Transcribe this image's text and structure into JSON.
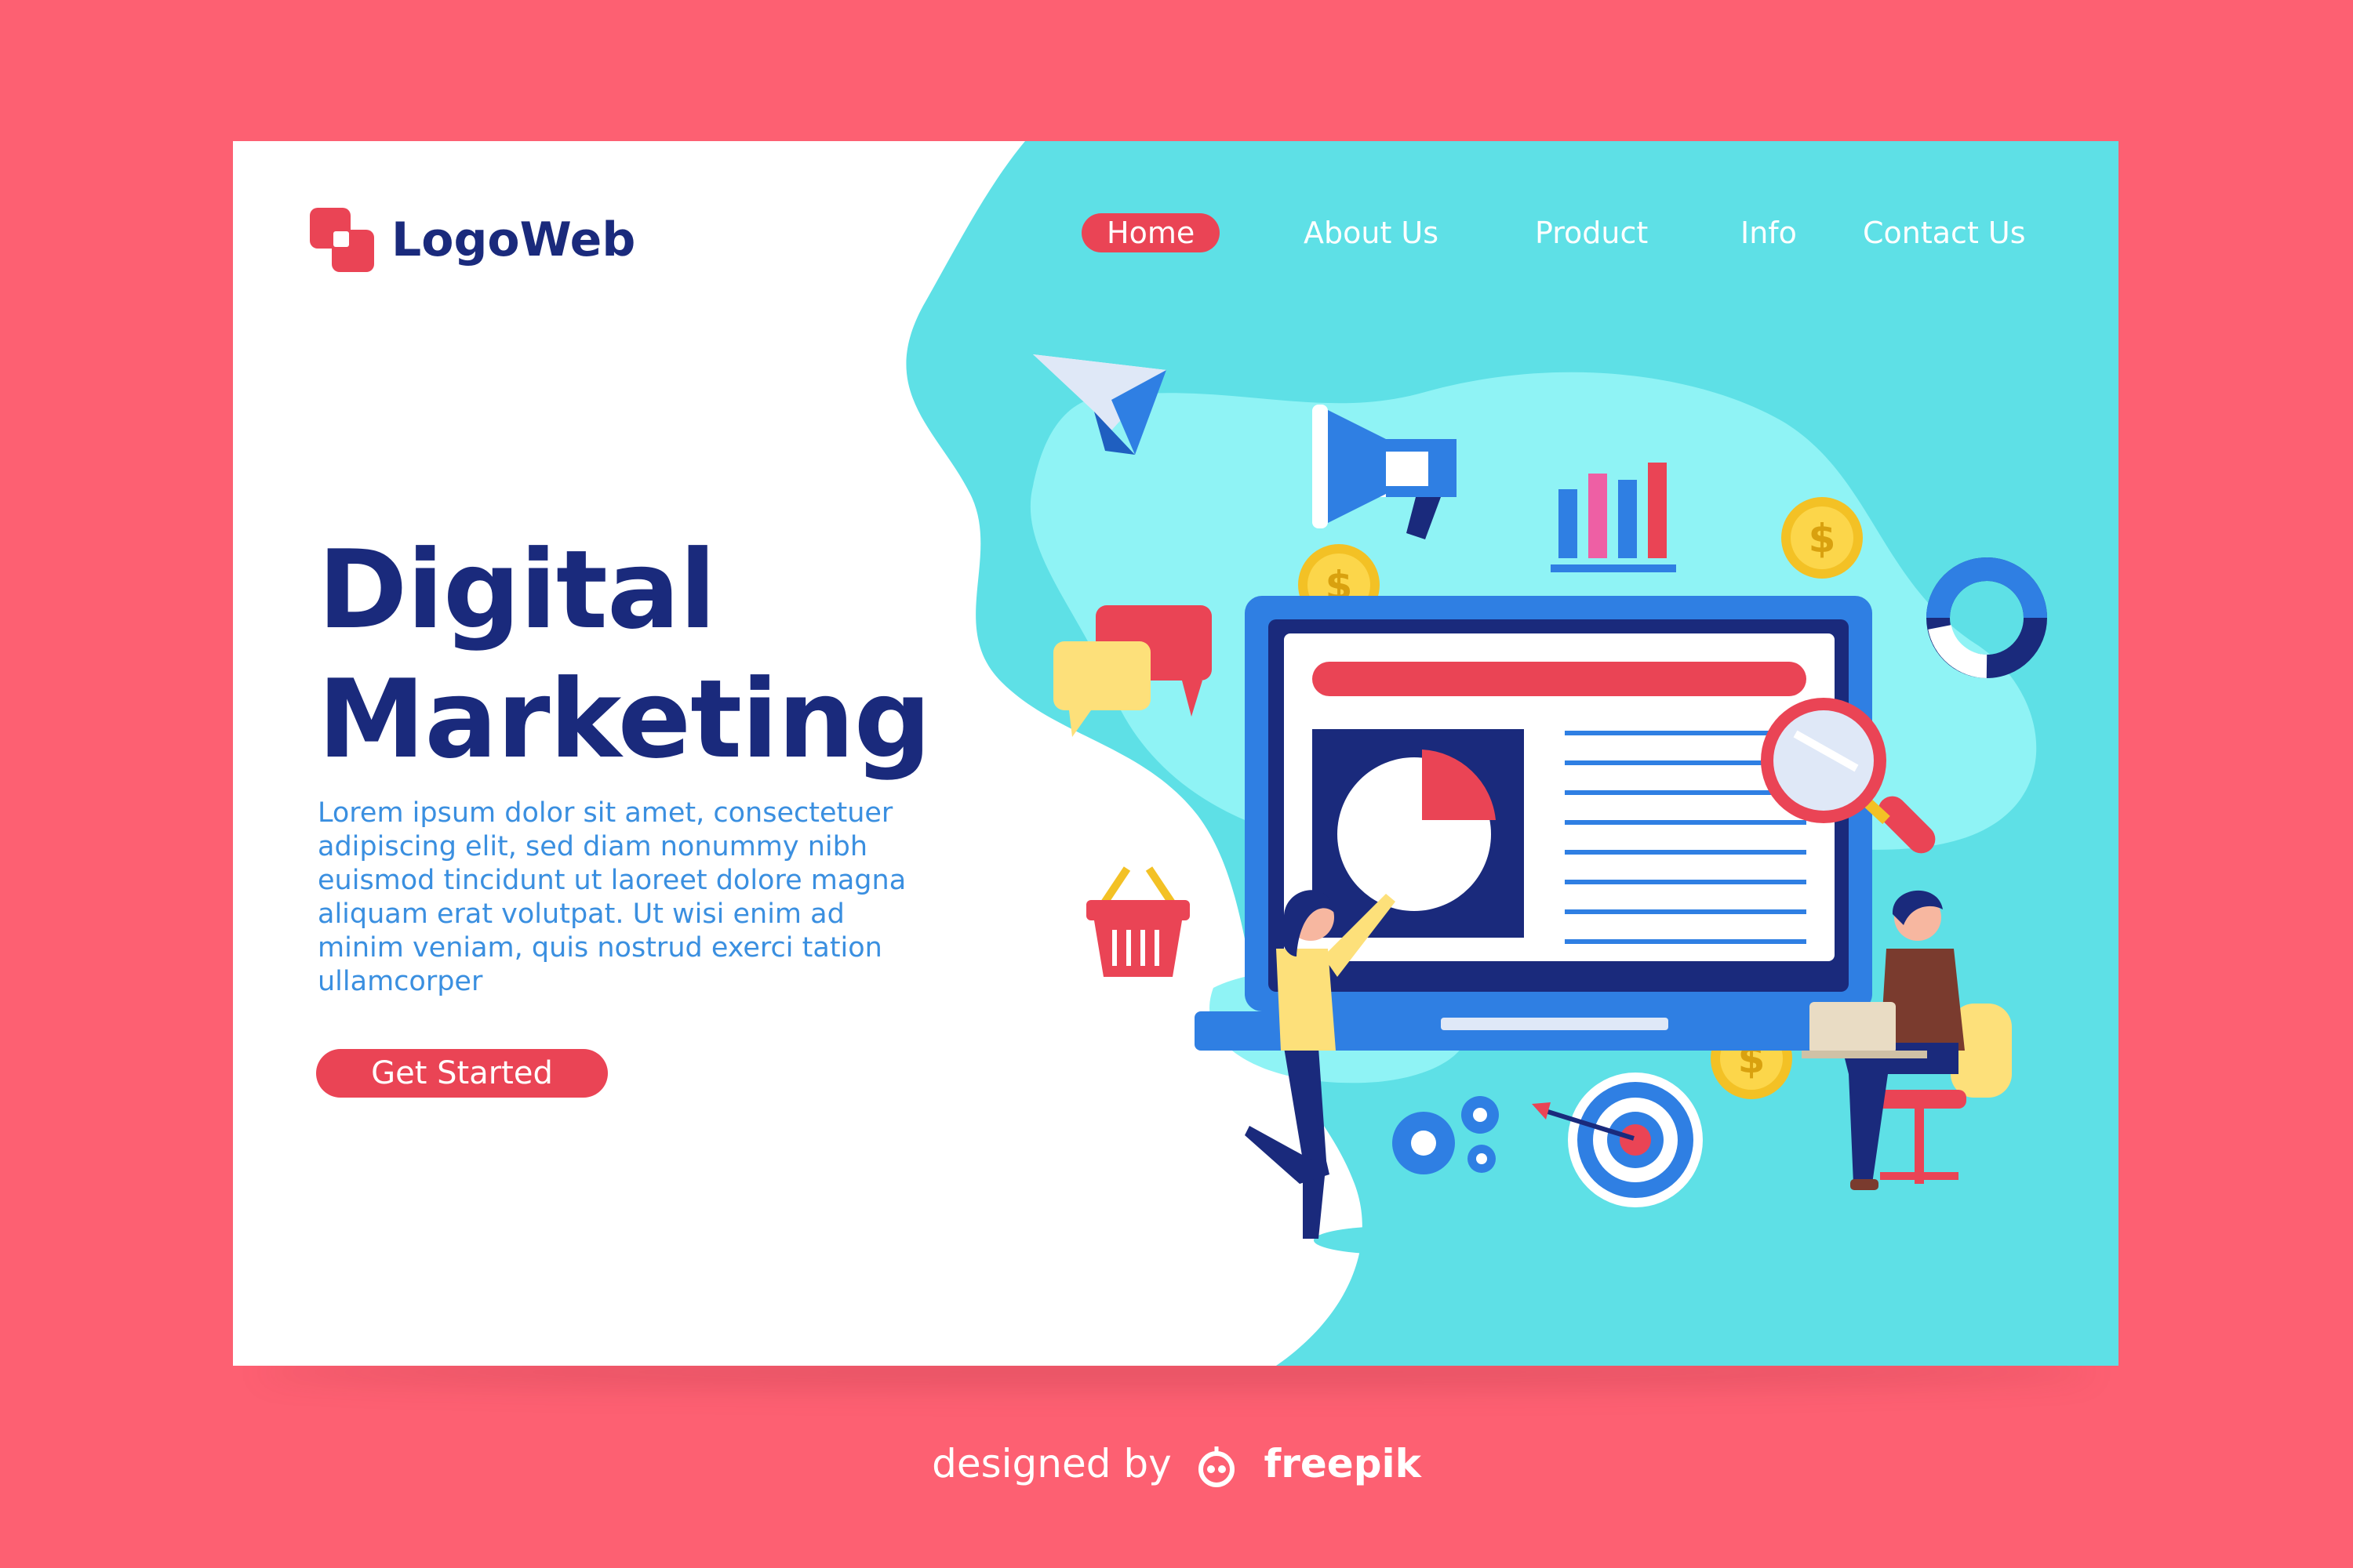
{
  "logo": {
    "text": "LogoWeb",
    "icon": "overlapping-squares-logo",
    "color": "#ea4455"
  },
  "nav": {
    "items": [
      {
        "label": "Home",
        "active": true
      },
      {
        "label": "About Us",
        "active": false
      },
      {
        "label": "Product",
        "active": false
      },
      {
        "label": "Info",
        "active": false
      },
      {
        "label": "Contact Us",
        "active": false
      }
    ]
  },
  "hero": {
    "title_line1": "Digital",
    "title_line2": "Marketing",
    "body": "Lorem ipsum dolor sit amet, consectetuer adipiscing elit, sed diam nonummy nibh euismod tincidunt ut laoreet dolore magna aliquam erat volutpat. Ut wisi enim ad minim veniam, quis nostrud exerci tation ullamcorper",
    "cta_label": "Get Started"
  },
  "illustration": {
    "icons": [
      "paper-plane-icon",
      "megaphone-icon",
      "bar-chart-icon",
      "dollar-coin-icon",
      "donut-chart-icon",
      "speech-bubbles-icon",
      "laptop-icon",
      "pie-chart-icon",
      "magnifier-icon",
      "shopping-basket-icon",
      "gears-icon",
      "target-icon",
      "person-pointing",
      "person-with-laptop"
    ]
  },
  "credit": {
    "prefix": "designed by",
    "brand": "freepik"
  },
  "colors": {
    "background": "#fd6072",
    "card": "#ffffff",
    "accent": "#ea4455",
    "navy": "#1a2a7c",
    "body_text": "#3a8fe0",
    "turquoise": "#5ee0e6",
    "light_cyan": "#8ff3f5"
  }
}
